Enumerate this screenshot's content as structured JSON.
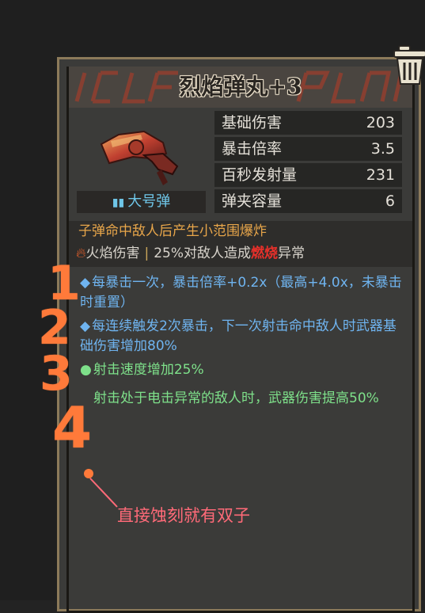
{
  "item": {
    "title": "烈焰弹丸+3",
    "ammo_type": "大号弹",
    "ammo_icon": "bullets-icon",
    "stats": [
      {
        "label": "基础伤害",
        "value": "203"
      },
      {
        "label": "暴击倍率",
        "value": "3.5"
      },
      {
        "label": "百秒发射量",
        "value": "231"
      },
      {
        "label": "弹夹容量",
        "value": "6"
      }
    ],
    "description": "子弹命中敌人后产生小范围爆炸",
    "damage_type": "火焰伤害",
    "effect_prefix": "25%对敌人造成",
    "effect_status": "燃烧",
    "effect_suffix": "异常",
    "traits": [
      {
        "bullet": "◆",
        "text": "每暴击一次，暴击倍率+0.2x（最高+4.0x，未暴击时重置）",
        "color": "#6fb4f0"
      },
      {
        "bullet": "◆",
        "text": "每连续触发2次暴击，下一次射击命中敌人时武器基础伤害增加80%",
        "color": "#6fb4f0"
      },
      {
        "bullet": "●",
        "text": "射击速度增加25%",
        "color": "#7ee08a"
      },
      {
        "bullet": "",
        "text": "射击处于电击异常的敌人时，武器伤害提高50%",
        "color": "#7ee08a"
      }
    ]
  },
  "annotation": {
    "numbers": [
      "1",
      "2",
      "3",
      "4"
    ],
    "note": "直接蚀刻就有双子",
    "color": "#ff7a3a",
    "note_color": "#ff6a78"
  },
  "colors": {
    "panel_bg": "#3b3b39",
    "panel_border": "#8c7a5a",
    "stat_bg": "#262624",
    "accent_orange": "#e8a64a",
    "burn_red": "#e8302a"
  }
}
